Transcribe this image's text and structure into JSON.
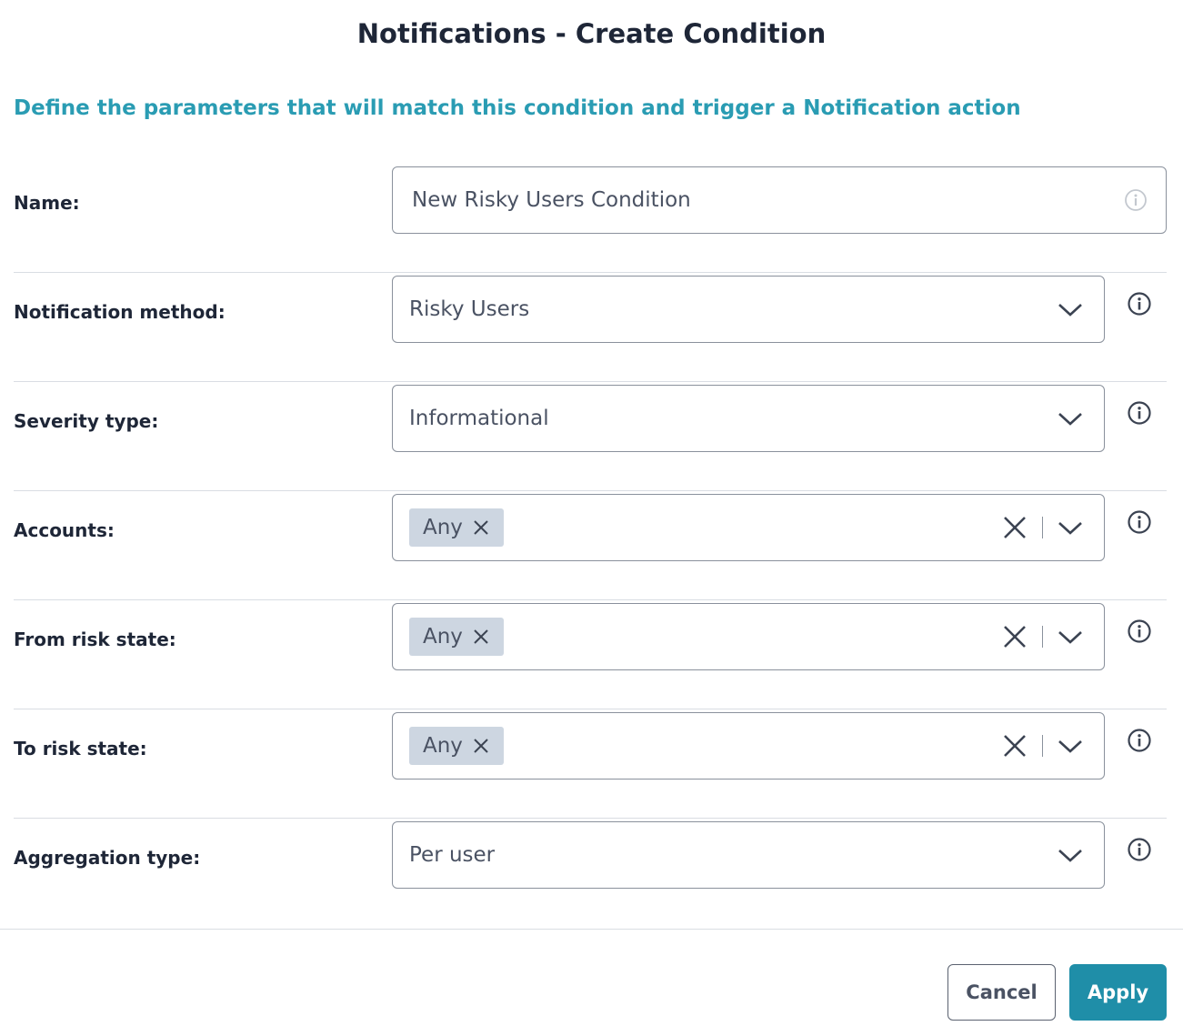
{
  "dialog": {
    "title": "Notifications - Create Condition",
    "subtitle": "Define the parameters that will match this condition and trigger a Notification action"
  },
  "fields": {
    "name": {
      "label": "Name:",
      "value": "New Risky Users Condition"
    },
    "notification_method": {
      "label": "Notification method:",
      "value": "Risky Users"
    },
    "severity_type": {
      "label": "Severity type:",
      "value": "Informational"
    },
    "accounts": {
      "label": "Accounts:",
      "chip": "Any"
    },
    "from_risk_state": {
      "label": "From risk state:",
      "chip": "Any"
    },
    "to_risk_state": {
      "label": "To risk state:",
      "chip": "Any"
    },
    "aggregation_type": {
      "label": "Aggregation type:",
      "value": "Per user"
    }
  },
  "buttons": {
    "cancel": "Cancel",
    "apply": "Apply"
  },
  "colors": {
    "accent": "#2a9cb3",
    "apply_bg": "#1f8ea8",
    "chip_bg": "#cdd6e1"
  },
  "icons": [
    "info-icon",
    "chevron-down-icon",
    "clear-icon",
    "remove-chip-icon"
  ]
}
